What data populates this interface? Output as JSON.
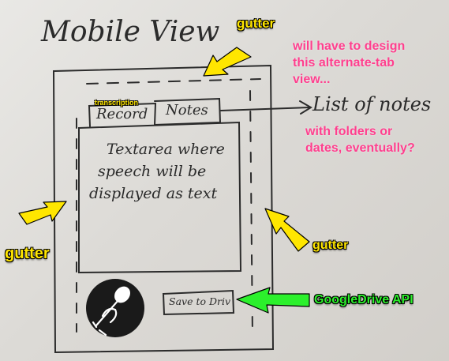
{
  "sketch": {
    "title": "Mobile View",
    "tab_record": "Record",
    "tab_notes": "Notes",
    "textarea_line1": "Textarea where",
    "textarea_line2": "speech will be",
    "textarea_line3": "displayed as text",
    "save_button": "Save to Drive",
    "list_of_notes": "List of notes"
  },
  "annotations": {
    "gutter_top": "gutter",
    "gutter_left": "gutter",
    "gutter_right": "gutter",
    "transcription": "transcription",
    "design_note_line1": "will have to design",
    "design_note_line2": "this alternate-tab",
    "design_note_line3": "view...",
    "folders_note_line1": "with folders or",
    "folders_note_line2": "dates, eventually?",
    "google_drive": "GoogleDrive API"
  },
  "colors": {
    "yellow": "#ffe600",
    "green": "#2cf02c",
    "pink": "#ff3f8e",
    "ink": "#2b2b2b"
  },
  "icons": {
    "microphone": "microphone-icon"
  }
}
